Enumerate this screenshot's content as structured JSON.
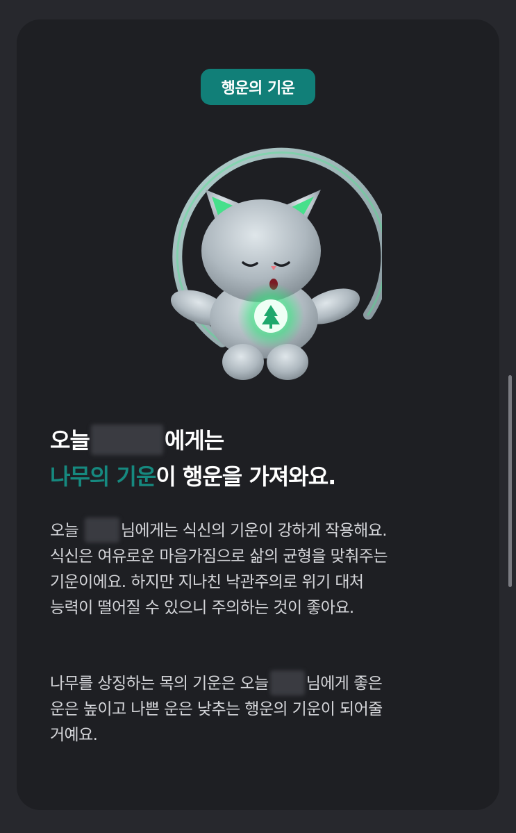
{
  "badge": {
    "label": "행운의 기운"
  },
  "mascot": {
    "chest_symbol": "tree-icon"
  },
  "heading": {
    "line1_prefix": "오늘",
    "line1_suffix": "에게는",
    "highlight": "나무의 기운",
    "line2_rest": "이 행운을 가져와요."
  },
  "paragraph1": {
    "lead": "오늘",
    "rest_of_line1": "님에게는 식신의 기운이 강하게 작용해요.",
    "line2": "식신은 여유로운 마음가짐으로 삶의 균형을 맞춰주는",
    "line3": "기운이에요. 하지만 지나친 낙관주의로 위기 대처",
    "line4": "능력이 떨어질 수 있으니 주의하는 것이 좋아요."
  },
  "paragraph2": {
    "line1_prefix": "나무를 상징하는 목의 기운은 오늘",
    "line1_suffix": "님에게 좋은",
    "line2": "운은 높이고 나쁜 운은 낮추는 행운의 기운이 되어줄",
    "line3": "거예요."
  },
  "colors": {
    "accent": "#117f78",
    "highlight_text": "#16897f",
    "card_bg": "#1e1f23",
    "page_bg": "#27282d"
  }
}
